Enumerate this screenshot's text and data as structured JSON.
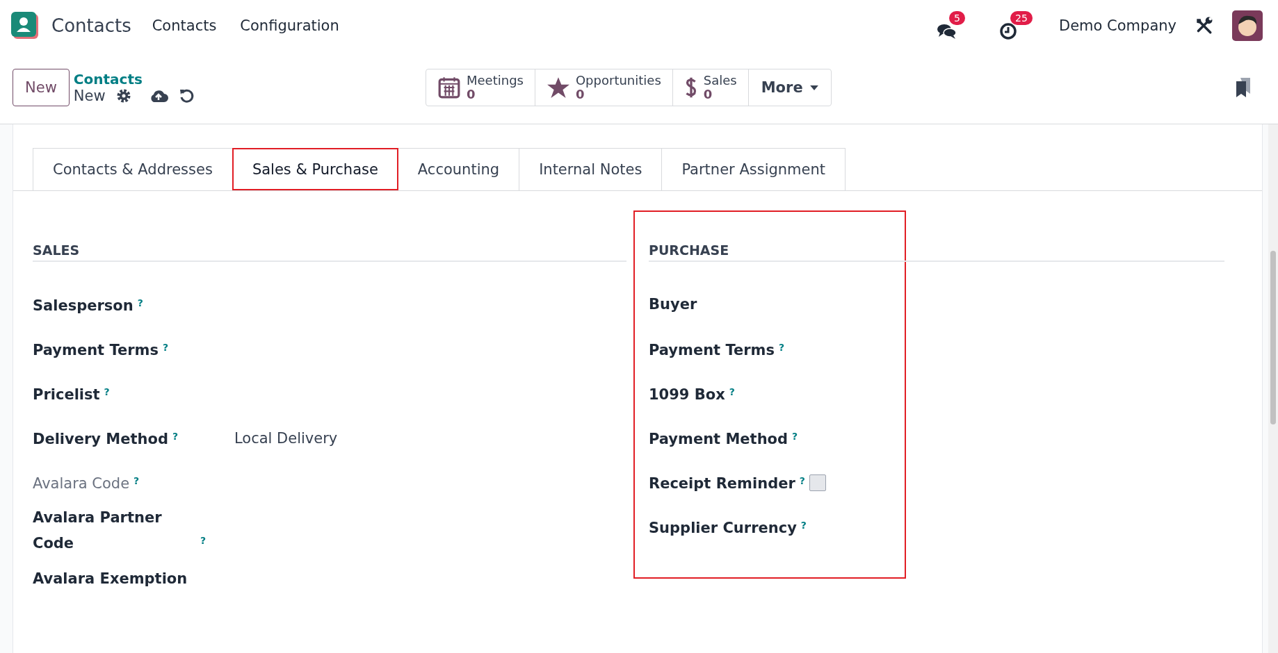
{
  "navbar": {
    "app_name": "Contacts",
    "menu": [
      "Contacts",
      "Configuration"
    ],
    "messages_count": "5",
    "activities_count": "25",
    "company": "Demo Company"
  },
  "control_panel": {
    "new_button": "New",
    "breadcrumb_parent": "Contacts",
    "breadcrumb_current": "New",
    "smart_buttons": [
      {
        "kind": "calendar",
        "label": "Meetings",
        "value": "0"
      },
      {
        "kind": "star",
        "label": "Opportunities",
        "value": "0"
      },
      {
        "kind": "dollar",
        "label": "Sales",
        "value": "0"
      }
    ],
    "more_button": "More"
  },
  "tabs": [
    {
      "label": "Contacts & Addresses",
      "selected": false,
      "highlighted": false
    },
    {
      "label": "Sales & Purchase",
      "selected": true,
      "highlighted": true
    },
    {
      "label": "Accounting",
      "selected": false,
      "highlighted": false
    },
    {
      "label": "Internal Notes",
      "selected": false,
      "highlighted": false
    },
    {
      "label": "Partner Assignment",
      "selected": false,
      "highlighted": false
    }
  ],
  "sections": [
    {
      "title": "SALES",
      "highlighted": false,
      "fields": [
        {
          "label": "Salesperson",
          "help": "?",
          "muted": false
        },
        {
          "label": "Payment Terms",
          "help": "?",
          "muted": false
        },
        {
          "label": "Pricelist",
          "help": "?",
          "muted": false
        },
        {
          "label": "Delivery Method",
          "help": "?",
          "muted": false,
          "value": "Local Delivery"
        },
        {
          "label": "Avalara Code",
          "help": "?",
          "muted": true
        },
        {
          "label": "Avalara Partner Code",
          "help": "?",
          "muted": false
        },
        {
          "label": "Avalara Exemption",
          "muted": false
        }
      ]
    },
    {
      "title": "PURCHASE",
      "highlighted": true,
      "fields": [
        {
          "label": "Buyer",
          "muted": false
        },
        {
          "label": "Payment Terms",
          "help": "?",
          "muted": false
        },
        {
          "label": "1099 Box",
          "help": "?",
          "muted": false
        },
        {
          "label": "Payment Method",
          "help": "?",
          "muted": false
        },
        {
          "label": "Receipt Reminder",
          "help": "?",
          "muted": false,
          "checked": false
        },
        {
          "label": "Supplier Currency",
          "help": "?",
          "muted": false
        }
      ]
    }
  ]
}
